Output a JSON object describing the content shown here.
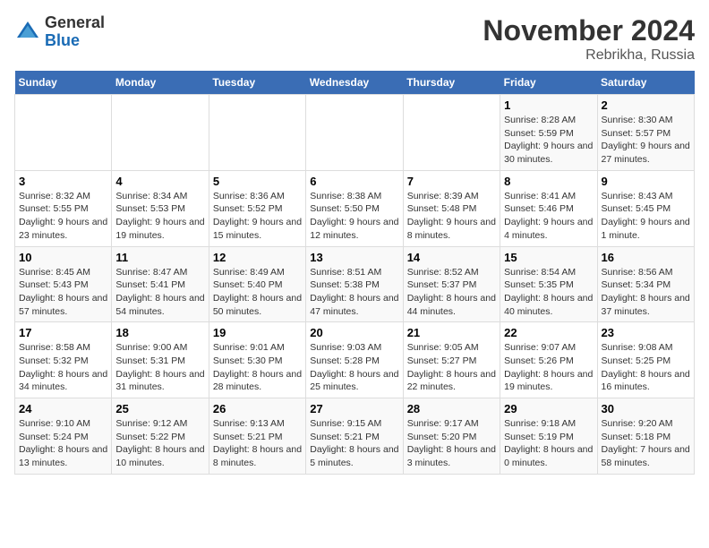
{
  "header": {
    "logo_line1": "General",
    "logo_line2": "Blue",
    "month": "November 2024",
    "location": "Rebrikha, Russia"
  },
  "days_of_week": [
    "Sunday",
    "Monday",
    "Tuesday",
    "Wednesday",
    "Thursday",
    "Friday",
    "Saturday"
  ],
  "weeks": [
    [
      {
        "day": "",
        "info": ""
      },
      {
        "day": "",
        "info": ""
      },
      {
        "day": "",
        "info": ""
      },
      {
        "day": "",
        "info": ""
      },
      {
        "day": "",
        "info": ""
      },
      {
        "day": "1",
        "info": "Sunrise: 8:28 AM\nSunset: 5:59 PM\nDaylight: 9 hours and 30 minutes."
      },
      {
        "day": "2",
        "info": "Sunrise: 8:30 AM\nSunset: 5:57 PM\nDaylight: 9 hours and 27 minutes."
      }
    ],
    [
      {
        "day": "3",
        "info": "Sunrise: 8:32 AM\nSunset: 5:55 PM\nDaylight: 9 hours and 23 minutes."
      },
      {
        "day": "4",
        "info": "Sunrise: 8:34 AM\nSunset: 5:53 PM\nDaylight: 9 hours and 19 minutes."
      },
      {
        "day": "5",
        "info": "Sunrise: 8:36 AM\nSunset: 5:52 PM\nDaylight: 9 hours and 15 minutes."
      },
      {
        "day": "6",
        "info": "Sunrise: 8:38 AM\nSunset: 5:50 PM\nDaylight: 9 hours and 12 minutes."
      },
      {
        "day": "7",
        "info": "Sunrise: 8:39 AM\nSunset: 5:48 PM\nDaylight: 9 hours and 8 minutes."
      },
      {
        "day": "8",
        "info": "Sunrise: 8:41 AM\nSunset: 5:46 PM\nDaylight: 9 hours and 4 minutes."
      },
      {
        "day": "9",
        "info": "Sunrise: 8:43 AM\nSunset: 5:45 PM\nDaylight: 9 hours and 1 minute."
      }
    ],
    [
      {
        "day": "10",
        "info": "Sunrise: 8:45 AM\nSunset: 5:43 PM\nDaylight: 8 hours and 57 minutes."
      },
      {
        "day": "11",
        "info": "Sunrise: 8:47 AM\nSunset: 5:41 PM\nDaylight: 8 hours and 54 minutes."
      },
      {
        "day": "12",
        "info": "Sunrise: 8:49 AM\nSunset: 5:40 PM\nDaylight: 8 hours and 50 minutes."
      },
      {
        "day": "13",
        "info": "Sunrise: 8:51 AM\nSunset: 5:38 PM\nDaylight: 8 hours and 47 minutes."
      },
      {
        "day": "14",
        "info": "Sunrise: 8:52 AM\nSunset: 5:37 PM\nDaylight: 8 hours and 44 minutes."
      },
      {
        "day": "15",
        "info": "Sunrise: 8:54 AM\nSunset: 5:35 PM\nDaylight: 8 hours and 40 minutes."
      },
      {
        "day": "16",
        "info": "Sunrise: 8:56 AM\nSunset: 5:34 PM\nDaylight: 8 hours and 37 minutes."
      }
    ],
    [
      {
        "day": "17",
        "info": "Sunrise: 8:58 AM\nSunset: 5:32 PM\nDaylight: 8 hours and 34 minutes."
      },
      {
        "day": "18",
        "info": "Sunrise: 9:00 AM\nSunset: 5:31 PM\nDaylight: 8 hours and 31 minutes."
      },
      {
        "day": "19",
        "info": "Sunrise: 9:01 AM\nSunset: 5:30 PM\nDaylight: 8 hours and 28 minutes."
      },
      {
        "day": "20",
        "info": "Sunrise: 9:03 AM\nSunset: 5:28 PM\nDaylight: 8 hours and 25 minutes."
      },
      {
        "day": "21",
        "info": "Sunrise: 9:05 AM\nSunset: 5:27 PM\nDaylight: 8 hours and 22 minutes."
      },
      {
        "day": "22",
        "info": "Sunrise: 9:07 AM\nSunset: 5:26 PM\nDaylight: 8 hours and 19 minutes."
      },
      {
        "day": "23",
        "info": "Sunrise: 9:08 AM\nSunset: 5:25 PM\nDaylight: 8 hours and 16 minutes."
      }
    ],
    [
      {
        "day": "24",
        "info": "Sunrise: 9:10 AM\nSunset: 5:24 PM\nDaylight: 8 hours and 13 minutes."
      },
      {
        "day": "25",
        "info": "Sunrise: 9:12 AM\nSunset: 5:22 PM\nDaylight: 8 hours and 10 minutes."
      },
      {
        "day": "26",
        "info": "Sunrise: 9:13 AM\nSunset: 5:21 PM\nDaylight: 8 hours and 8 minutes."
      },
      {
        "day": "27",
        "info": "Sunrise: 9:15 AM\nSunset: 5:21 PM\nDaylight: 8 hours and 5 minutes."
      },
      {
        "day": "28",
        "info": "Sunrise: 9:17 AM\nSunset: 5:20 PM\nDaylight: 8 hours and 3 minutes."
      },
      {
        "day": "29",
        "info": "Sunrise: 9:18 AM\nSunset: 5:19 PM\nDaylight: 8 hours and 0 minutes."
      },
      {
        "day": "30",
        "info": "Sunrise: 9:20 AM\nSunset: 5:18 PM\nDaylight: 7 hours and 58 minutes."
      }
    ]
  ]
}
